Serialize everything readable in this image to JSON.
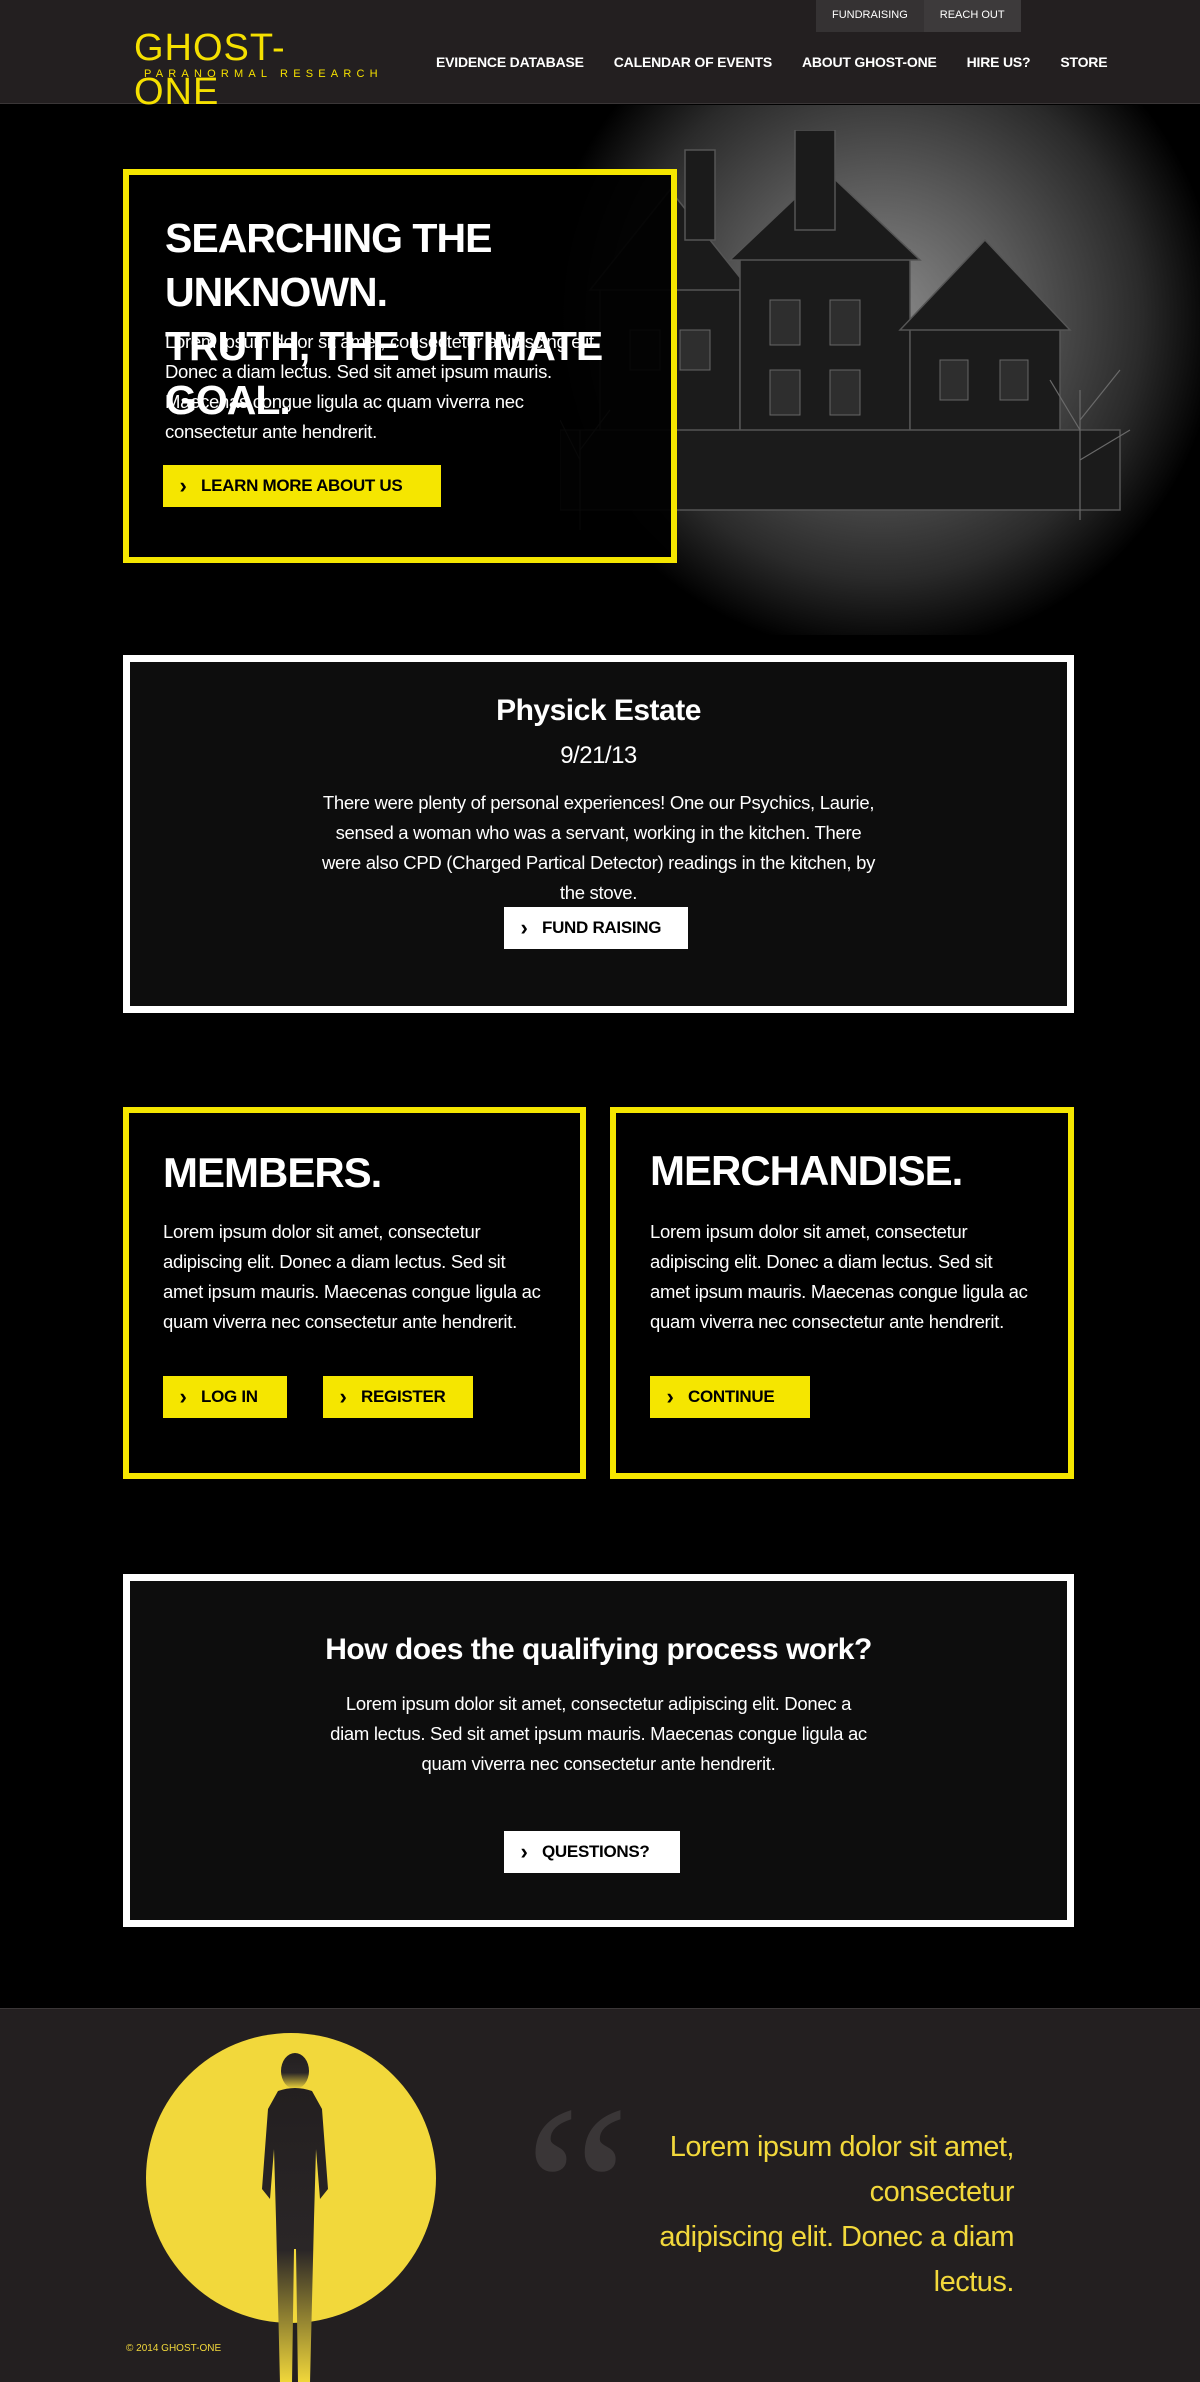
{
  "header": {
    "logo": {
      "main": "GHOST-ONE",
      "sub": "PARANORMAL RESEARCH"
    },
    "util_nav": [
      "FUNDRAISING",
      "REACH OUT"
    ],
    "main_nav": [
      "EVIDENCE DATABASE",
      "CALENDAR OF EVENTS",
      "ABOUT GHOST-ONE",
      "HIRE US?",
      "STORE"
    ]
  },
  "hero": {
    "title_line1": "SEARCHING THE UNKNOWN.",
    "title_line2": "TRUTH, THE ULTIMATE GOAL.",
    "text": "Lorem ipsum dolor sit amet, consectetur adipiscing elit. Donec a diam lectus. Sed sit amet ipsum mauris. Maecenas congue ligula ac quam viverra nec consectetur ante hendrerit.",
    "button": "LEARN MORE ABOUT US"
  },
  "event": {
    "title": "Physick Estate",
    "date": "9/21/13",
    "text": "There were plenty of personal experiences! One our Psychics, Laurie, sensed a woman who was a servant, working in the kitchen. There were also CPD (Charged Partical Detector) readings in the kitchen, by the stove.",
    "button": "FUND RAISING"
  },
  "members": {
    "title": "MEMBERS.",
    "text": "Lorem ipsum dolor sit amet, consectetur adipiscing elit. Donec a diam lectus. Sed sit amet ipsum mauris. Maecenas congue ligula ac quam viverra nec consectetur ante hendrerit.",
    "login": "LOG IN",
    "register": "REGISTER"
  },
  "merchandise": {
    "title": "MERCHANDISE.",
    "text": "Lorem ipsum dolor sit amet, consectetur adipiscing elit. Donec a diam lectus. Sed sit amet ipsum mauris. Maecenas congue ligula ac quam viverra nec consectetur ante hendrerit.",
    "button": "CONTINUE"
  },
  "qualify": {
    "title": "How does the qualifying process work?",
    "text": "Lorem ipsum dolor sit amet, consectetur adipiscing elit. Donec a diam lectus. Sed sit amet ipsum mauris. Maecenas congue ligula ac quam viverra nec consectetur ante hendrerit.",
    "button": "QUESTIONS?"
  },
  "footer": {
    "quote_mark": "“",
    "quote_line1": "Lorem ipsum dolor sit amet, consectetur",
    "quote_line2": "adipiscing elit. Donec a diam lectus.",
    "copyright": "© 2014 GHOST-ONE"
  },
  "icons": {
    "chevron": "chevron-right-icon",
    "quote": "quote-icon"
  },
  "colors": {
    "accent": "#f5e600",
    "header_bg": "#231f20",
    "footer_accent": "#f2d83b"
  }
}
